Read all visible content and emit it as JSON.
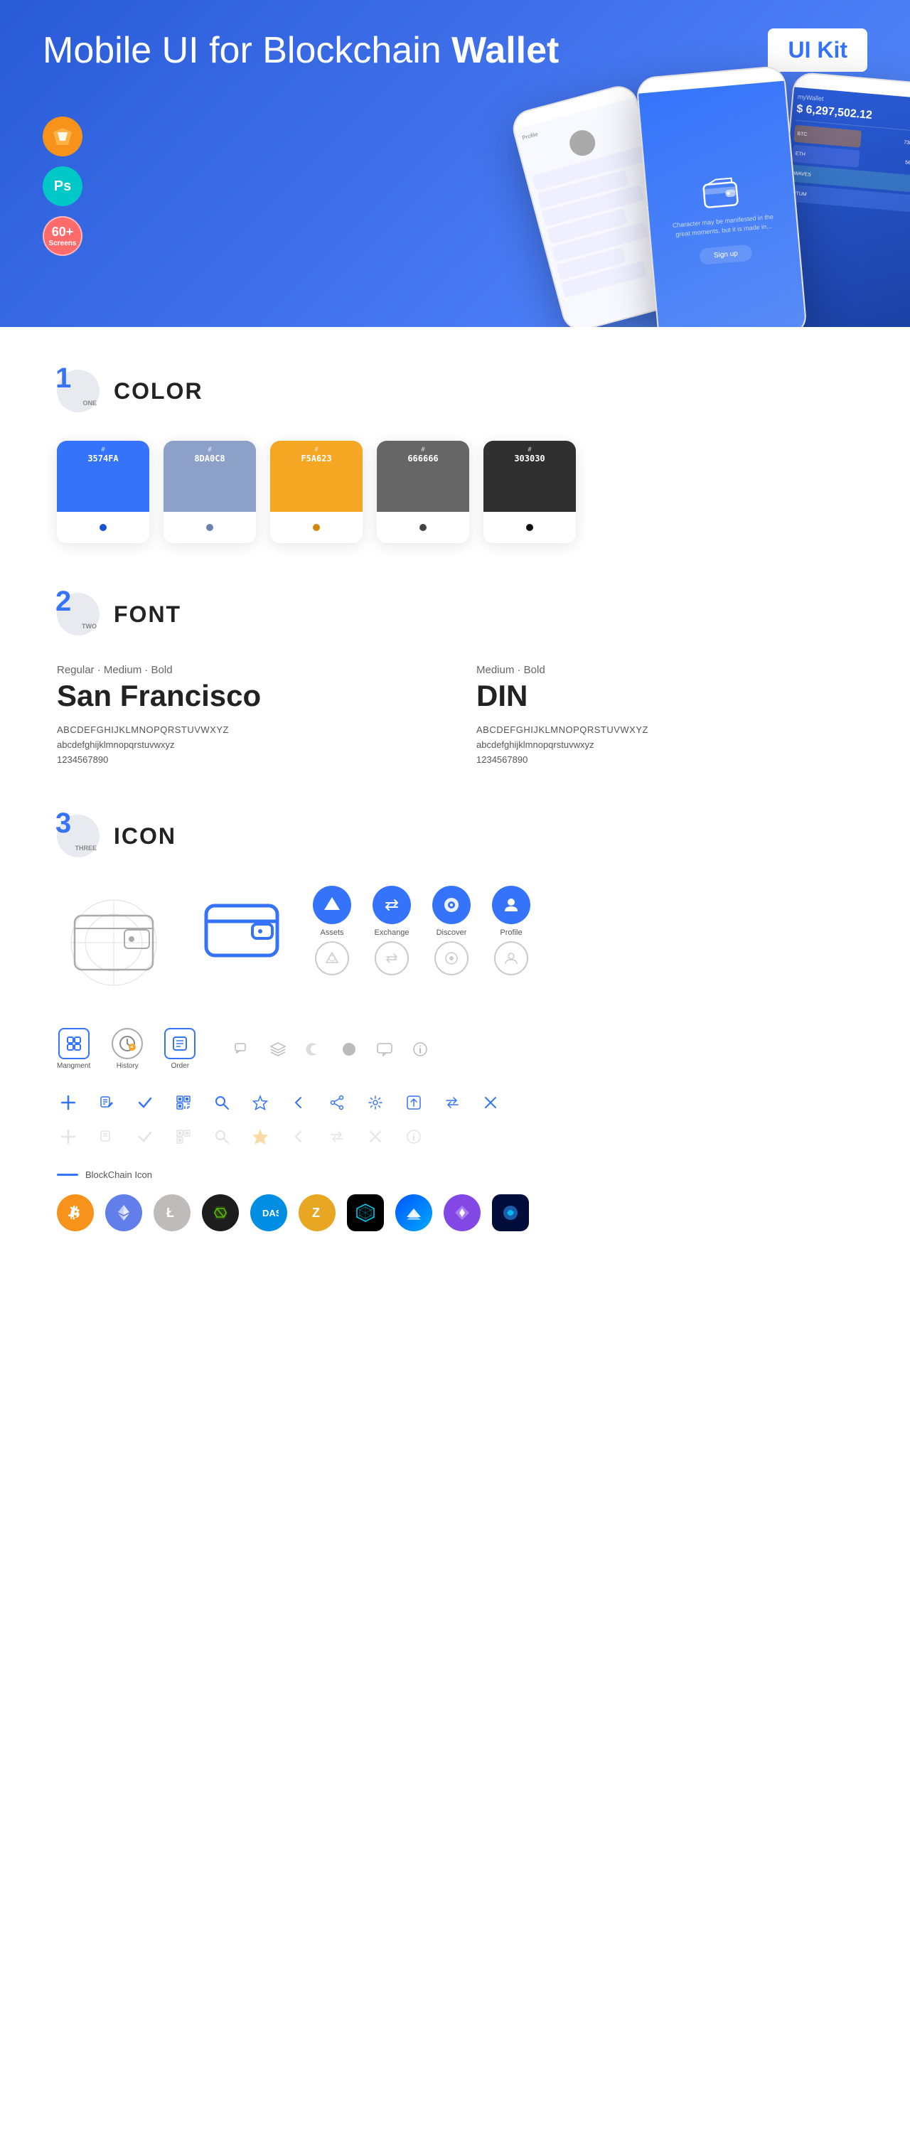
{
  "hero": {
    "title_normal": "Mobile UI for Blockchain ",
    "title_bold": "Wallet",
    "badge": "UI Kit",
    "tool1": "Sk",
    "tool2": "Ps",
    "screens_count": "60+",
    "screens_label": "Screens"
  },
  "sections": {
    "color": {
      "number": "1",
      "word": "ONE",
      "title": "COLOR",
      "swatches": [
        {
          "hex": "3574FA",
          "color": "#3574FA",
          "dot": "#1a52d4"
        },
        {
          "hex": "8DA0C8",
          "color": "#8DA0C8",
          "dot": "#6a82b0"
        },
        {
          "hex": "F5A623",
          "color": "#F5A623",
          "dot": "#d4880a"
        },
        {
          "hex": "666666",
          "color": "#666666",
          "dot": "#444"
        },
        {
          "hex": "303030",
          "color": "#303030",
          "dot": "#111"
        }
      ]
    },
    "font": {
      "number": "2",
      "word": "TWO",
      "title": "FONT",
      "fonts": [
        {
          "styles": "Regular · Medium · Bold",
          "name": "San Francisco",
          "class": "",
          "upper": "ABCDEFGHIJKLMNOPQRSTUVWXYZ",
          "lower": "abcdefghijklmnopqrstuvwxyz",
          "nums": "1234567890"
        },
        {
          "styles": "Medium · Bold",
          "name": "DIN",
          "class": "din",
          "upper": "ABCDEFGHIJKLMNOPQRSTUVWXYZ",
          "lower": "abcdefghijklmnopqrstuvwxyz",
          "nums": "1234567890"
        }
      ]
    },
    "icon": {
      "number": "3",
      "word": "THREE",
      "title": "ICON",
      "nav_icons": [
        {
          "label": "Assets",
          "icon": "◆"
        },
        {
          "label": "Exchange",
          "icon": "⇌"
        },
        {
          "label": "Discover",
          "icon": "●"
        },
        {
          "label": "Profile",
          "icon": "👤"
        }
      ],
      "bottom_icons": [
        {
          "label": "Mangment",
          "type": "square"
        },
        {
          "label": "History",
          "type": "clock"
        },
        {
          "label": "Order",
          "type": "list"
        }
      ],
      "blockchain_label": "BlockChain Icon",
      "crypto_icons": [
        "BTC",
        "ETH",
        "LTC",
        "NEO",
        "DASH",
        "ZEC",
        "GRID",
        "WAVES",
        "MATIC",
        "BNT"
      ]
    }
  }
}
